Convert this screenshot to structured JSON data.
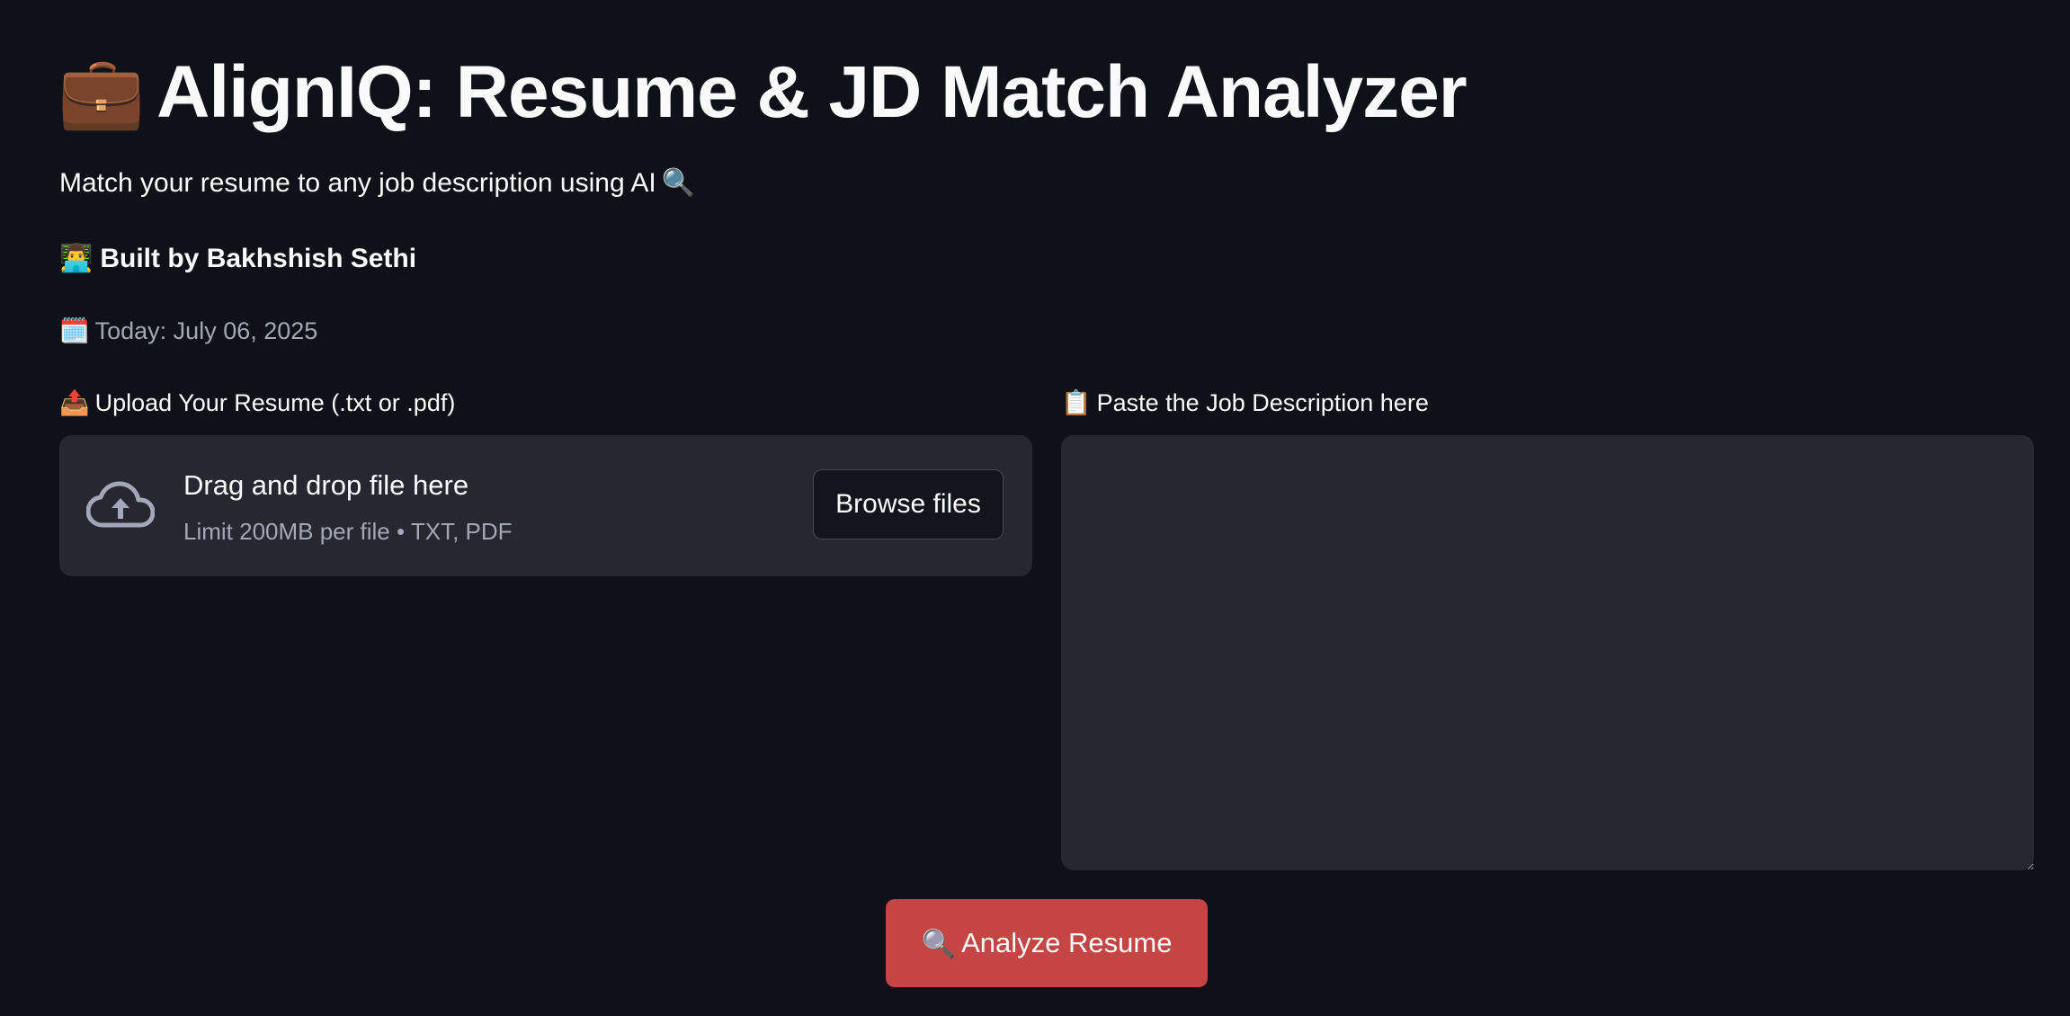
{
  "header": {
    "title_icon": "briefcase-emoji",
    "title_icon_glyph": "💼",
    "title": "AlignIQ: Resume & JD Match Analyzer",
    "subtitle": "Match your resume to any job description using AI",
    "subtitle_icon_glyph": "🔍",
    "byline_icon_glyph": "👨‍💻",
    "byline": "Built by Bakhshish Sethi",
    "date_icon_glyph": "🗓️",
    "date_text": "Today: July 06, 2025"
  },
  "upload": {
    "label_icon_glyph": "📤",
    "label": "Upload Your Resume (.txt or .pdf)",
    "drop_title": "Drag and drop file here",
    "drop_limit": "Limit 200MB per file • TXT, PDF",
    "browse_label": "Browse files",
    "icon": "cloud-upload-icon"
  },
  "job_description": {
    "label_icon_glyph": "📋",
    "label": "Paste the Job Description here",
    "value": ""
  },
  "analyze": {
    "icon_glyph": "🔍",
    "label": "Analyze Resume"
  },
  "colors": {
    "background": "#0e1117",
    "surface": "#262730",
    "primary_button": "#c44544",
    "muted_text": "#a3a8b8",
    "text": "#fafafa"
  }
}
